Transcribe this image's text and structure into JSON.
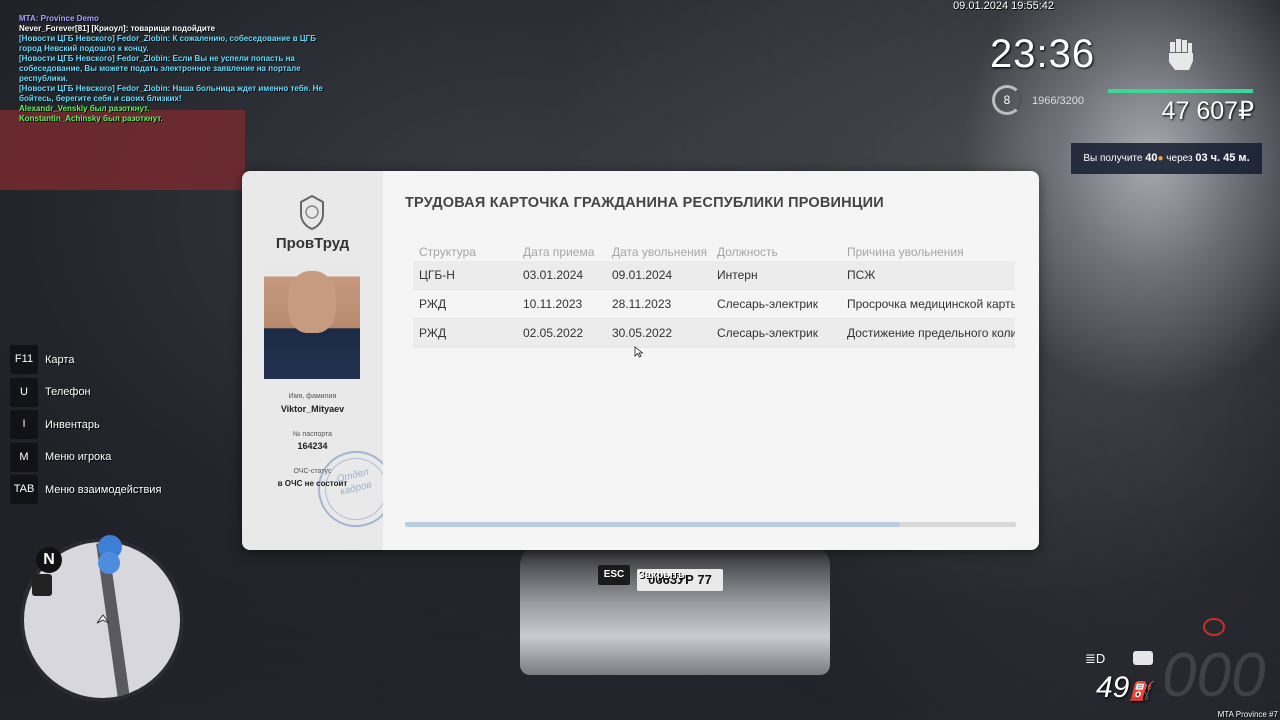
{
  "chat": [
    {
      "text": "MTA: Province Demo",
      "color": "#a9a6ff"
    },
    {
      "text": "Never_Forever[81] [Криоул]: товарищи подойдите",
      "color": "#ffffff"
    },
    {
      "text": "[Новости ЦГБ Невского] Fedor_Zlobin: К сожалению, собеседование в ЦГБ город Невский подошло к концу.",
      "color": "#5fe1ff"
    },
    {
      "text": "[Новости ЦГБ Невского] Fedor_Zlobin: Если Вы не успели попасть на собеседование, Вы можете подать электронное заявление на портале республики.",
      "color": "#5fe1ff"
    },
    {
      "text": "[Новости ЦГБ Невского] Fedor_Zlobin: Наша больница ждет именно тебя. Не бойтесь, берегите себя и своих близких!",
      "color": "#5fe1ff"
    },
    {
      "text": "Alexandr_Venskiy был разоткнут.",
      "color": "#5df45d"
    },
    {
      "text": "Konstantin_Achinsky был разоткнут.",
      "color": "#5df45d"
    }
  ],
  "hud": {
    "datetime": "09.01.2024 19:55:42",
    "clock": "23:36",
    "level": "8",
    "exp": "1966/3200",
    "money": "47 607₽",
    "bonus_prefix": "Вы получите ",
    "bonus_amount": "40",
    "bonus_mid": " через ",
    "bonus_time": "03 ч. 45 м.",
    "speed": "49",
    "gear_ghost": "000",
    "footer": "MTA Province #7"
  },
  "binds": [
    {
      "key": "F11",
      "label": "Карта"
    },
    {
      "key": "U",
      "label": "Телефон"
    },
    {
      "key": "I",
      "label": "Инвентарь"
    },
    {
      "key": "M",
      "label": "Меню игрока"
    },
    {
      "key": "TAB",
      "label": "Меню взаимодействия"
    }
  ],
  "map": {
    "north": "N"
  },
  "plate": "0663УР 77",
  "card": {
    "brand": "ПровТруд",
    "name_label": "Имя, фамилия",
    "name": "Viktor_Mityaev",
    "passport_label": "№ паспорта",
    "passport": "164234",
    "status_label": "ОЧС-статус",
    "status": "в ОЧС не состоит",
    "stamp_line1": "Отдел",
    "stamp_line2": "кадров",
    "title": "ТРУДОВАЯ КАРТОЧКА ГРАЖДАНИНА РЕСПУБЛИКИ ПРОВИНЦИИ",
    "columns": [
      "Структура",
      "Дата приема",
      "Дата увольнения",
      "Должность",
      "Причина увольнения"
    ],
    "rows": [
      [
        "ЦГБ-Н",
        "03.01.2024",
        "09.01.2024",
        "Интерн",
        "ПСЖ"
      ],
      [
        "РЖД",
        "10.11.2023",
        "28.11.2023",
        "Слесарь-электрик",
        "Просрочка медицинской карты"
      ],
      [
        "РЖД",
        "02.05.2022",
        "30.05.2022",
        "Слесарь-электрик",
        "Достижение предельного количества"
      ]
    ],
    "scroll_fraction": 0.81
  },
  "esc": {
    "key": "ESC",
    "label": "Закрыть"
  }
}
